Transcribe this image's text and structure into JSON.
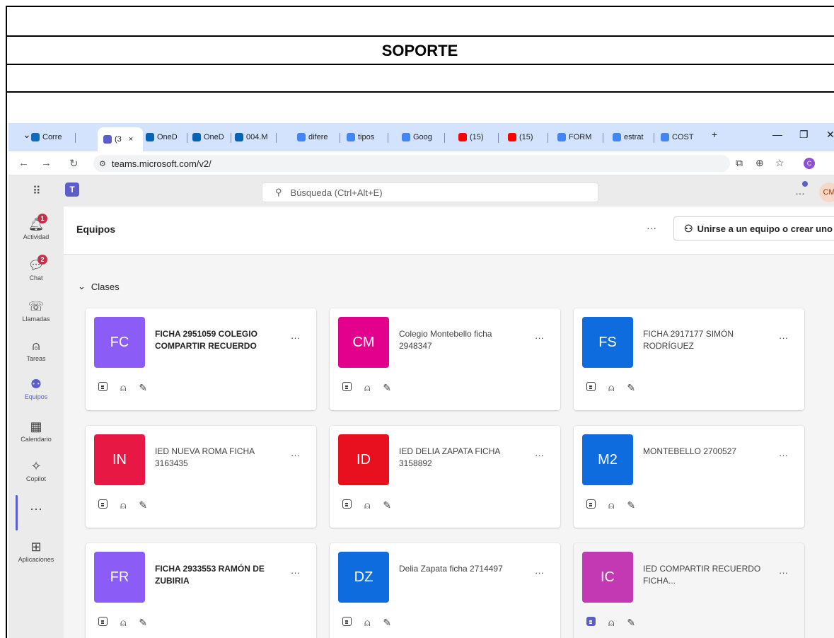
{
  "document": {
    "title": "SOPORTE"
  },
  "browser": {
    "tabs": [
      {
        "label": "Corre",
        "icon": "outlook-icon",
        "color": "#0f6cbd"
      },
      {
        "label": "(3",
        "icon": "teams-icon",
        "color": "#5b5fc7",
        "active": true,
        "close": "×"
      },
      {
        "label": "OneD",
        "icon": "onedrive-icon",
        "color": "#0364b8"
      },
      {
        "label": "OneD",
        "icon": "onedrive-icon",
        "color": "#0364b8"
      },
      {
        "label": "004.M",
        "icon": "onedrive-icon",
        "color": "#0364b8"
      },
      {
        "label": "difere",
        "icon": "google-icon",
        "color": "#4285f4"
      },
      {
        "label": "tipos",
        "icon": "google-icon",
        "color": "#4285f4"
      },
      {
        "label": "Goog",
        "icon": "google-icon",
        "color": "#4285f4"
      },
      {
        "label": "(15)",
        "icon": "youtube-icon",
        "color": "#ff0000"
      },
      {
        "label": "(15)",
        "icon": "youtube-icon",
        "color": "#ff0000"
      },
      {
        "label": "FORM",
        "icon": "google-icon",
        "color": "#4285f4"
      },
      {
        "label": "estrat",
        "icon": "google-icon",
        "color": "#4285f4"
      },
      {
        "label": "COST",
        "icon": "google-icon",
        "color": "#4285f4"
      }
    ],
    "new_tab": "+",
    "url": "teams.microsoft.com/v2/",
    "profile_initial": "C"
  },
  "teams": {
    "search_placeholder": "Búsqueda (Ctrl+Alt+E)",
    "avatar_initials": "CM",
    "rail": [
      {
        "label": "Actividad",
        "icon": "bell-icon",
        "badge": "1"
      },
      {
        "label": "Chat",
        "icon": "chat-icon",
        "badge": "2"
      },
      {
        "label": "Llamadas",
        "icon": "phone-icon"
      },
      {
        "label": "Tareas",
        "icon": "backpack-icon"
      },
      {
        "label": "Equipos",
        "icon": "teams-people-icon",
        "active": true
      },
      {
        "label": "Calendario",
        "icon": "calendar-icon"
      },
      {
        "label": "Copilot",
        "icon": "copilot-icon"
      },
      {
        "label": "...",
        "icon": "more-icon"
      },
      {
        "label": "Aplicaciones",
        "icon": "add-apps-icon"
      }
    ],
    "page_title": "Equipos",
    "join_button": "Unirse a un equipo o crear uno",
    "section_label": "Clases",
    "cards": [
      {
        "initials": "FC",
        "name": "FICHA 2951059 COLEGIO COMPARTIR RECUERDO",
        "color": "#8b5cf6",
        "bold": true
      },
      {
        "initials": "CM",
        "name": "Colegio Montebello ficha 2948347",
        "color": "#e3008c",
        "bold": false
      },
      {
        "initials": "FS",
        "name": "FICHA 2917177 SIMÓN RODRÍGUEZ",
        "color": "#0f6cde",
        "bold": false
      },
      {
        "initials": "IN",
        "name": "IED NUEVA ROMA FICHA 3163435",
        "color": "#e81845",
        "bold": false
      },
      {
        "initials": "ID",
        "name": "IED DELIA ZAPATA FICHA 3158892",
        "color": "#e8101e",
        "bold": false
      },
      {
        "initials": "M2",
        "name": "MONTEBELLO 2700527",
        "color": "#0f6cde",
        "bold": false
      },
      {
        "initials": "FR",
        "name": "FICHA 2933553 RAMÓN DE ZUBIRIA",
        "color": "#8b5cf6",
        "bold": true
      },
      {
        "initials": "DZ",
        "name": "Delia Zapata ficha 2714497",
        "color": "#0f6cde",
        "bold": false
      },
      {
        "initials": "IC",
        "name": "IED COMPARTIR RECUERDO FICHA...",
        "color": "#c239b3",
        "bold": false
      }
    ]
  }
}
